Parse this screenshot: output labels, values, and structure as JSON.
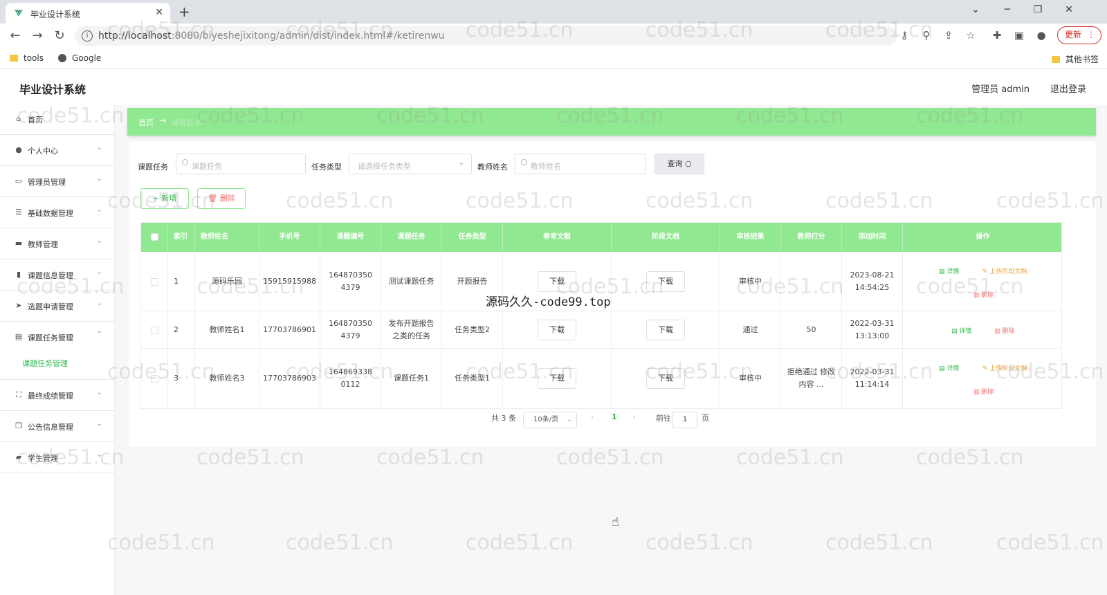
{
  "browser": {
    "tab_title": "毕业设计系统",
    "tab_close": "✕",
    "new_tab": "+",
    "url_host": "http://localhost",
    "url_rest": ":8080/biyeshejixitong/admin/dist/index.html#/ketirenwu",
    "update_label": "更新",
    "bookmarks": [
      "tools",
      "Google"
    ],
    "other_bookmarks": "其他书签"
  },
  "app": {
    "title": "毕业设计系统",
    "user": "管理员 admin",
    "logout": "退出登录"
  },
  "sidebar": {
    "items": [
      {
        "label": "首页",
        "icon": "home-icon"
      },
      {
        "label": "个人中心",
        "icon": "user-icon"
      },
      {
        "label": "管理员管理",
        "icon": "admin-icon"
      },
      {
        "label": "基础数据管理",
        "icon": "sliders-icon"
      },
      {
        "label": "教师管理",
        "icon": "briefcase-icon"
      },
      {
        "label": "课题信息管理",
        "icon": "book-icon"
      },
      {
        "label": "选题申请管理",
        "icon": "send-icon"
      },
      {
        "label": "课题任务管理",
        "icon": "document-icon"
      },
      {
        "label": "最终成绩管理",
        "icon": "frame-icon"
      },
      {
        "label": "公告信息管理",
        "icon": "copy-icon"
      },
      {
        "label": "学生管理",
        "icon": "graduate-icon"
      }
    ],
    "active_sub": "课题任务管理"
  },
  "breadcrumb": {
    "home": "首页",
    "arrow": "→",
    "current": "课题任务"
  },
  "filters": {
    "task_label": "课题任务",
    "task_placeholder": "课题任务",
    "type_label": "任务类型",
    "type_placeholder": "请选择任务类型",
    "teacher_label": "教师姓名",
    "teacher_placeholder": "教师姓名",
    "query": "查询"
  },
  "actions": {
    "add": "+ 新增",
    "delete": "删除"
  },
  "table": {
    "headers": [
      "索引",
      "教师姓名",
      "手机号",
      "课题编号",
      "课题任务",
      "任务类型",
      "参考文献",
      "阶段文档",
      "审核结果",
      "教师打分",
      "添加时间",
      "操作"
    ],
    "download_label": "下载",
    "rows": [
      {
        "index": "1",
        "teacher": "源码乐园",
        "phone": "15915915988",
        "code": "1648703504379",
        "task": "测试课题任务",
        "type": "开题报告",
        "review": "审核中",
        "score": "",
        "time": "2023-08-21 14:54:25",
        "ops": [
          "详情",
          "上传阶段文档",
          "删除"
        ]
      },
      {
        "index": "2",
        "teacher": "教师姓名1",
        "phone": "17703786901",
        "code": "1648703504379",
        "task": "发布开题报告之类的任务",
        "type": "任务类型2",
        "review": "通过",
        "score": "50",
        "time": "2022-03-31 13:13:00",
        "ops": [
          "详情",
          "删除"
        ]
      },
      {
        "index": "3",
        "teacher": "教师姓名3",
        "phone": "17703786903",
        "code": "1648693380112",
        "task": "课题任务1",
        "type": "任务类型1",
        "review": "审核中",
        "score": "拒绝通过 修改内容 ...",
        "time": "2022-03-31 11:14:14",
        "ops": [
          "详情",
          "上传阶段文档",
          "删除"
        ]
      }
    ]
  },
  "pagination": {
    "total": "共 3 条",
    "page_size": "10条/页",
    "current_page": "1",
    "goto_prefix": "前往",
    "goto_value": "1",
    "goto_suffix": "页"
  },
  "overlay_text": "源码久久-code99.top",
  "watermark": "code51.cn",
  "colors": {
    "accent": "#90e890",
    "accent_text": "#2db84d",
    "danger": "#f56c6c",
    "warning": "#e6a23c"
  }
}
